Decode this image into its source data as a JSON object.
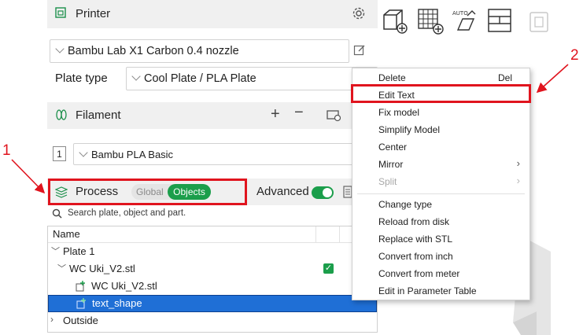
{
  "printer": {
    "title": "Printer",
    "preset": "Bambu Lab X1 Carbon 0.4 nozzle"
  },
  "plate": {
    "label": "Plate type",
    "value": "Cool Plate / PLA Plate"
  },
  "filament": {
    "title": "Filament",
    "slot": "1",
    "value": "Bambu PLA Basic"
  },
  "process": {
    "title": "Process",
    "toggle_global": "Global",
    "toggle_objects": "Objects",
    "advanced_label": "Advanced",
    "search_placeholder": "Search plate, object and part."
  },
  "tree": {
    "header_name": "Name",
    "plate": "Plate 1",
    "object": "WC Uki_V2.stl",
    "part1": "WC Uki_V2.stl",
    "part2": "text_shape",
    "outside": "Outside"
  },
  "context_menu": {
    "delete": "Delete",
    "delete_shortcut": "Del",
    "edit_text": "Edit Text",
    "fix_model": "Fix model",
    "simplify": "Simplify Model",
    "center": "Center",
    "mirror": "Mirror",
    "split": "Split",
    "change_type": "Change type",
    "reload": "Reload from disk",
    "replace": "Replace with STL",
    "convert_inch": "Convert from inch",
    "convert_meter": "Convert from meter",
    "edit_param": "Edit in Parameter Table"
  },
  "toolbar": {
    "auto_label": "AUTO"
  },
  "annotations": {
    "callout1": "1",
    "callout2": "2"
  },
  "colors": {
    "accent_green": "#1b9e4b",
    "selection_blue": "#1f6fd6",
    "annotation_red": "#e0141e"
  }
}
